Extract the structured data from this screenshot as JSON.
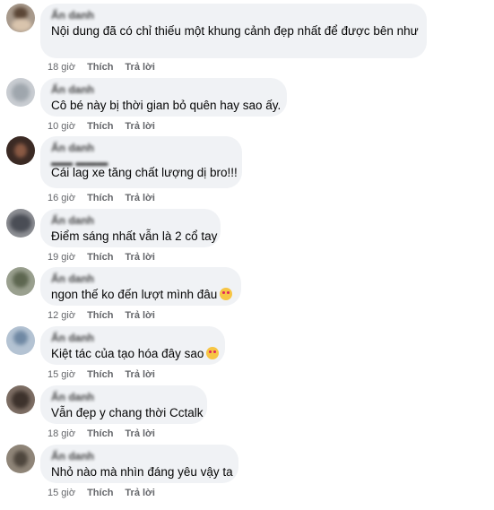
{
  "actions": {
    "like": "Thích",
    "reply": "Trả lời"
  },
  "comments": [
    {
      "author": "Ẩn danh",
      "text": "Nội dung đã có chỉ thiếu một khung cảnh đẹp nhất để được bên như",
      "time": "18 giờ"
    },
    {
      "author": "Ẩn danh",
      "text": "Cô bé này bị thời gian bỏ quên hay sao ấy.",
      "time": "10 giờ"
    },
    {
      "author": "Ẩn danh",
      "text": "Cái lag xe tăng chất lượng dị bro!!!",
      "time": "16 giờ"
    },
    {
      "author": "Ẩn danh",
      "text": "Điểm sáng nhất vẫn là 2 cổ tay",
      "time": "19 giờ"
    },
    {
      "author": "Ẩn danh",
      "text": "ngon thế ko đến lượt mình đâu",
      "emoji": "rolling-laughing-emoji",
      "time": "12 giờ"
    },
    {
      "author": "Ẩn danh",
      "text": "Kiệt tác của tạo hóa đây sao",
      "emoji": "heart-eyes-emoji",
      "time": "15 giờ"
    },
    {
      "author": "Ẩn danh",
      "text": "Vẫn đẹp y chang thời Cctalk",
      "time": "18 giờ"
    },
    {
      "author": "Ẩn danh",
      "text": "Nhỏ nào mà nhìn đáng yêu vậy ta",
      "time": "15 giờ"
    }
  ]
}
